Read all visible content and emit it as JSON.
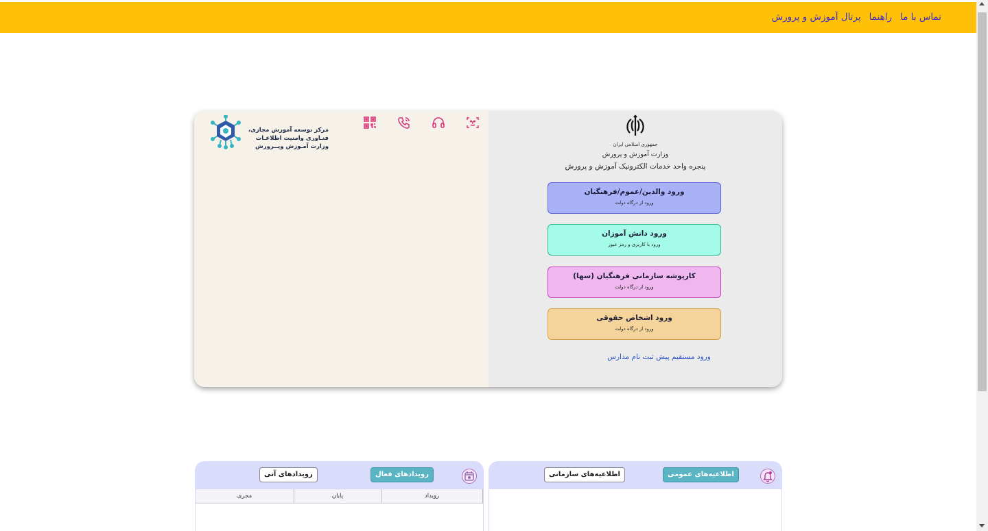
{
  "header": {
    "nav": [
      "پرتال آموزش و پرورش",
      "راهنما",
      "تماس با ما"
    ],
    "color": "#ffc107"
  },
  "left_panel": {
    "logo_text": [
      "مرکز توسعه آموزش مجازی،",
      "فنـاوری وامنیت اطلاعـات",
      "وزارت آمـوزش وپــرورش"
    ],
    "logo_icon": "center-logo-icon",
    "toolbar_icons": [
      "qr-code-icon",
      "phone-icon",
      "headset-icon",
      "face-id-icon"
    ]
  },
  "right_panel": {
    "emblem": "iran-emblem-icon",
    "org_line1": "جمهوری اسلامی ایران",
    "org_line2": "وزارت آموزش و پرورش",
    "org_line3": "پنجره واحد خدمات الکترونیک آموزش و پرورش",
    "buttons": [
      {
        "title": "ورود والدین/عموم/فرهنگیان",
        "subtitle": "ورود از درگاه دولت",
        "color": "#a9b2f7"
      },
      {
        "title": "ورود دانش آموزان",
        "subtitle": "ورود با کاربری و رمز عبور",
        "color": "#a4fbe7"
      },
      {
        "title": "کارپوشه سازمانی فرهنگیان (سها)",
        "subtitle": "ورود از درگاه دولت",
        "color": "#f0b6ee"
      },
      {
        "title": "ورود اشخاص حقوقی",
        "subtitle": "ورود از درگاه دولت",
        "color": "#f4d49a"
      }
    ],
    "direct_link": "ورود مستقیم پیش ثبت نام مدارس"
  },
  "events": {
    "tab_active": "رویدادهای فعال",
    "tab_inactive": "رویدادهای آتی",
    "icon": "calendar-icon",
    "columns": [
      "رویداد",
      "پایان",
      "مجری"
    ]
  },
  "notices": {
    "tab_active": "اطلاعیه‌های عمومی",
    "tab_inactive": "اطلاعیه‌های سازمانی",
    "icon": "bell-icon"
  }
}
